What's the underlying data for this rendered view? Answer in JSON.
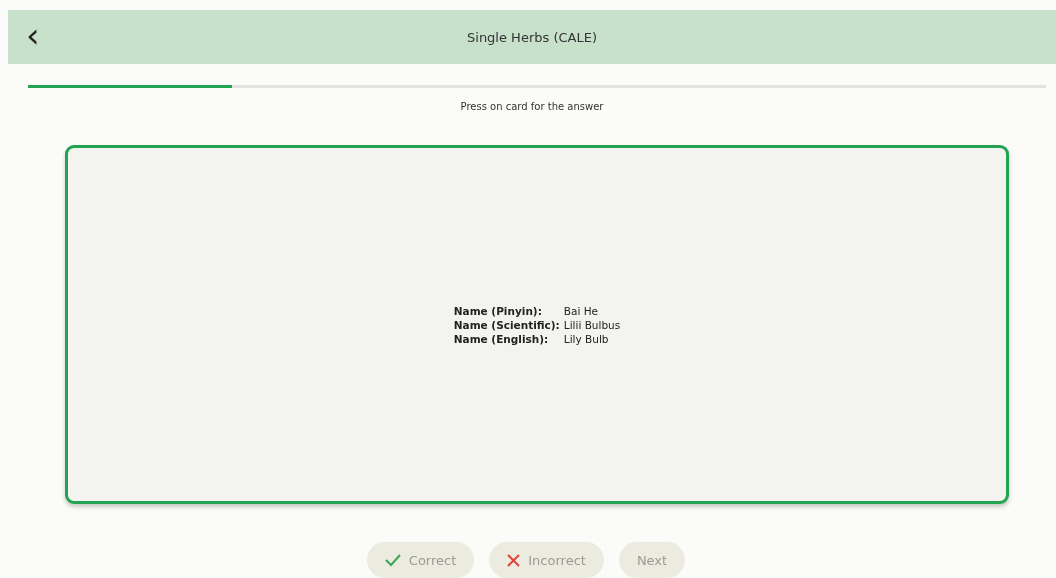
{
  "header": {
    "back": "‹",
    "title": "Single Herbs (CALE)"
  },
  "progress": {
    "level": 0.2
  },
  "hint": "Press on card for the answer",
  "card": {
    "fields": [
      {
        "label": "Name (Pinyin):",
        "value": "Bai He"
      },
      {
        "label": "Name (Scientific):",
        "value": "Lilii Bulbus"
      },
      {
        "label": "Name (English):",
        "value": "Lily Bulb"
      }
    ]
  },
  "buttons": [
    {
      "kind": "correct",
      "label": "Correct",
      "disabled": true
    },
    {
      "kind": "incorrect",
      "label": "Incorrect",
      "disabled": true
    },
    {
      "kind": "next",
      "label": "Next",
      "disabled": true
    }
  ]
}
